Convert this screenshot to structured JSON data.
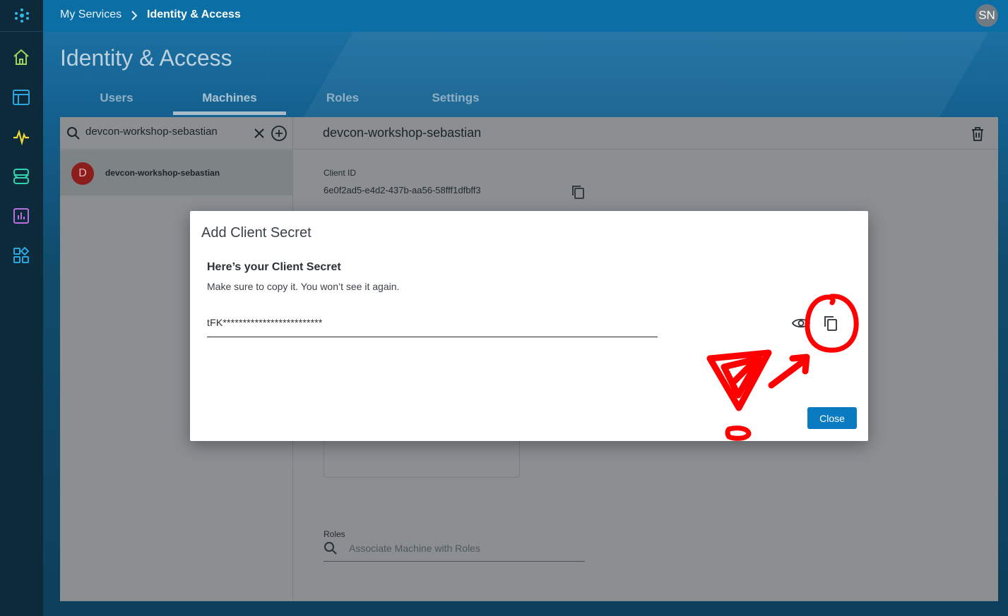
{
  "breadcrumb": {
    "parent": "My Services",
    "current": "Identity & Access"
  },
  "user": {
    "initials": "SN"
  },
  "page": {
    "title": "Identity & Access"
  },
  "tabs": [
    {
      "label": "Users"
    },
    {
      "label": "Machines",
      "active": true
    },
    {
      "label": "Roles"
    },
    {
      "label": "Settings"
    }
  ],
  "search": {
    "value": "devcon-workshop-sebastian"
  },
  "machines": [
    {
      "initial": "D",
      "name": "devcon-workshop-sebastian"
    }
  ],
  "detail": {
    "title": "devcon-workshop-sebastian",
    "client_id_label": "Client ID",
    "client_id_value": "6e0f2ad5-e4d2-437b-aa56-58fff1dfbff3",
    "roles_label": "Roles",
    "roles_placeholder": "Associate Machine with Roles"
  },
  "modal": {
    "title": "Add Client Secret",
    "heading": "Here’s your Client Secret",
    "subtext": "Make sure to copy it. You won’t see it again.",
    "secret_masked": "tFK*************************",
    "close_label": "Close"
  },
  "rail_icons": [
    "home-icon",
    "dashboard-icon",
    "activity-icon",
    "services-icon",
    "reports-icon",
    "apps-icon"
  ],
  "colors": {
    "topbar": "#0b6fa6",
    "rail": "#0d2a3a",
    "primary_button": "#0a7bc1",
    "annotation": "#ff0000"
  }
}
